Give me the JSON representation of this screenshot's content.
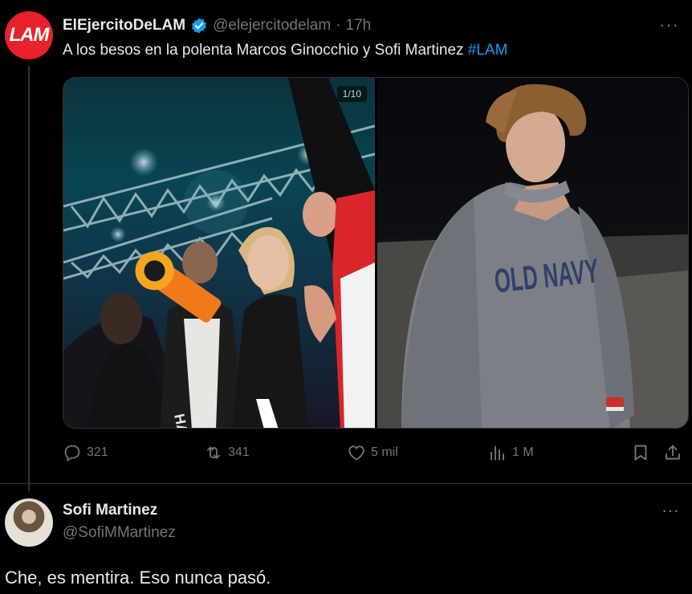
{
  "tweet": {
    "avatar_text": "LAM",
    "display_name": "ElEjercitoDeLAM",
    "handle": "@elejercitodelam",
    "separator": "·",
    "time": "17h",
    "text_before": "A los besos en la polenta Marcos Ginocchio y Sofi Martinez ",
    "hashtag": "#LAM",
    "media_counter": "1/10",
    "sweater_text": "OLD NAVY",
    "shirt_text": "HARRY",
    "more": "···",
    "actions": {
      "replies": "321",
      "reposts": "341",
      "likes": "5 mil",
      "views": "1 M"
    }
  },
  "reply": {
    "display_name": "Sofi Martinez",
    "handle": "@SofiMMartinez",
    "more": "···",
    "text": "Che, es mentira. Eso nunca pasó."
  },
  "colors": {
    "background": "#000000",
    "muted": "#71767b",
    "link": "#1d9bf0",
    "verified": "#1d9bf0",
    "lam_red": "#e8212b"
  }
}
